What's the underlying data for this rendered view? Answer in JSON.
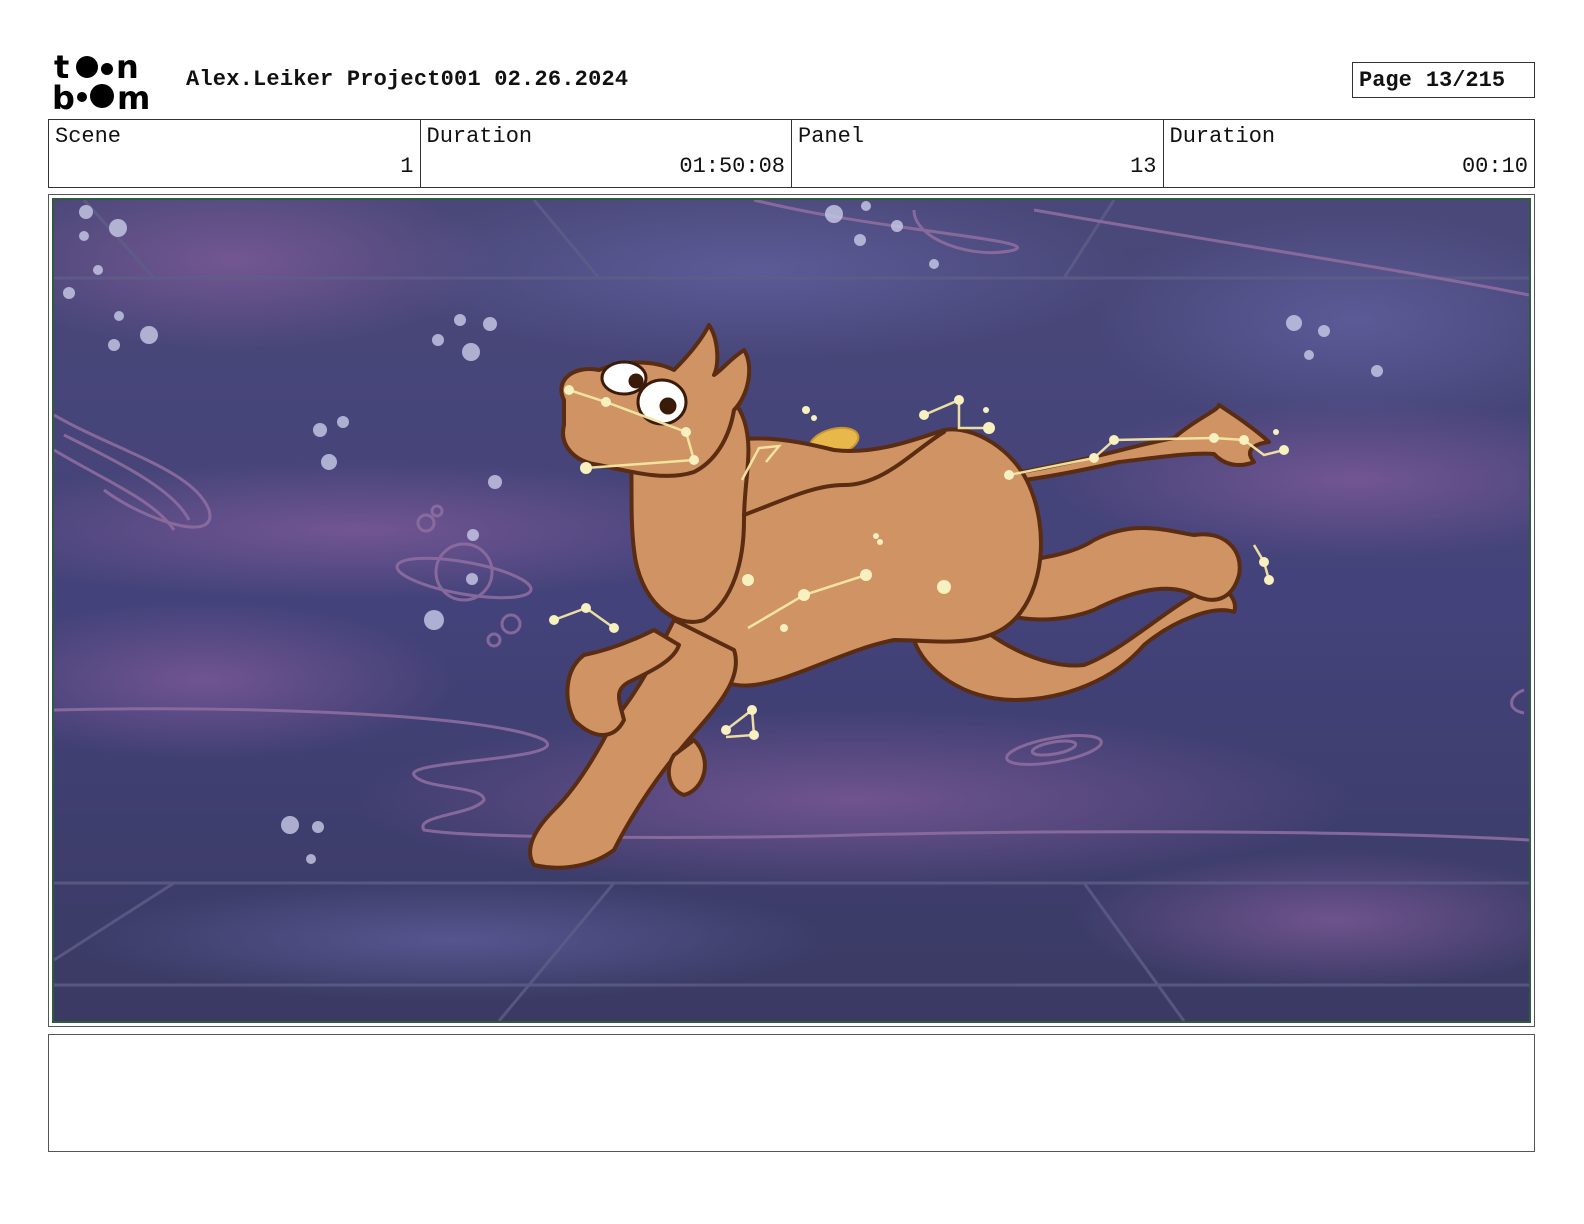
{
  "header": {
    "logo": {
      "top_word": "toon",
      "bottom_word": "boom",
      "icon": "toon-boom-logo"
    },
    "project_title": "Alex.Leiker Project001 02.26.2024",
    "page": {
      "label": "Page",
      "value": "13/215"
    }
  },
  "info": {
    "scene_label": "Scene",
    "scene_value": "1",
    "scene_duration_label": "Duration",
    "scene_duration_value": "01:50:08",
    "panel_label": "Panel",
    "panel_value": "13",
    "panel_duration_label": "Duration",
    "panel_duration_value": "00:10"
  },
  "panel_image": {
    "subject": "cartoon-horse-with-constellations-floating-in-space",
    "colors": {
      "space": "#3f3d6b",
      "nebula": "#7a5a9c",
      "horse": "#cf9364",
      "outline": "#5a2c12",
      "constellation": "#f4e7a3",
      "halo": "#e8b84a"
    }
  },
  "notes": {
    "text": ""
  }
}
